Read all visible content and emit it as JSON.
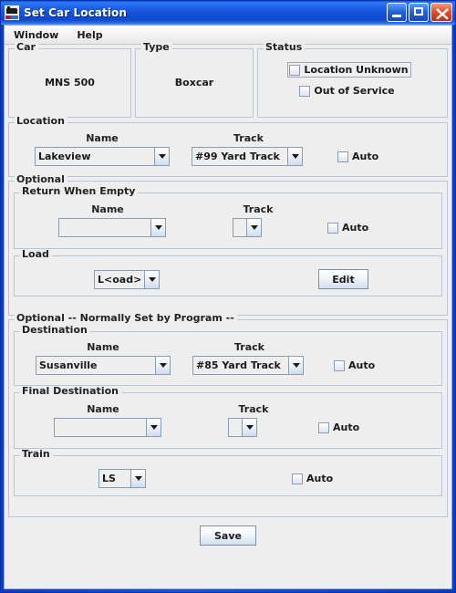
{
  "window": {
    "title": "Set Car Location",
    "icon": "locomotive-icon",
    "controls": {
      "minimize": "Minimize",
      "maximize": "Maximize",
      "close": "Close"
    },
    "frame_color": "#1a4fe0"
  },
  "menubar": {
    "items": [
      {
        "label": "Window"
      },
      {
        "label": "Help"
      }
    ]
  },
  "car_panel": {
    "legend": "Car",
    "value": "MNS 500"
  },
  "type_panel": {
    "legend": "Type",
    "value": "Boxcar"
  },
  "status_panel": {
    "legend": "Status",
    "location_unknown": {
      "label": "Location Unknown",
      "checked": false,
      "focused": true
    },
    "out_of_service": {
      "label": "Out of Service",
      "checked": false,
      "focused": false
    }
  },
  "location": {
    "legend": "Location",
    "name_header": "Name",
    "track_header": "Track",
    "name_value": "Lakeview",
    "track_value": "#99 Yard Track",
    "auto_label": "Auto",
    "auto_checked": false
  },
  "optional": {
    "legend": "Optional",
    "return_when_empty": {
      "legend": "Return When Empty",
      "name_header": "Name",
      "track_header": "Track",
      "name_value": "",
      "track_value": "",
      "auto_label": "Auto",
      "auto_checked": false
    },
    "load": {
      "legend": "Load",
      "value": "L<oad>",
      "edit_label": "Edit"
    }
  },
  "program_optional": {
    "legend": "Optional -- Normally Set by Program --",
    "destination": {
      "legend": "Destination",
      "name_header": "Name",
      "track_header": "Track",
      "name_value": "Susanville",
      "track_value": "#85 Yard Track",
      "auto_label": "Auto",
      "auto_checked": false
    },
    "final_destination": {
      "legend": "Final Destination",
      "name_header": "Name",
      "track_header": "Track",
      "name_value": "",
      "track_value": "",
      "auto_label": "Auto",
      "auto_checked": false
    },
    "train": {
      "legend": "Train",
      "value": "LS",
      "auto_label": "Auto",
      "auto_checked": false
    }
  },
  "footer": {
    "save_label": "Save"
  },
  "colors": {
    "panel_bg": "#eeeeee",
    "group_border": "#b8c6d9",
    "title_bar": "#1a4fe0",
    "close_button": "#e2502a"
  }
}
